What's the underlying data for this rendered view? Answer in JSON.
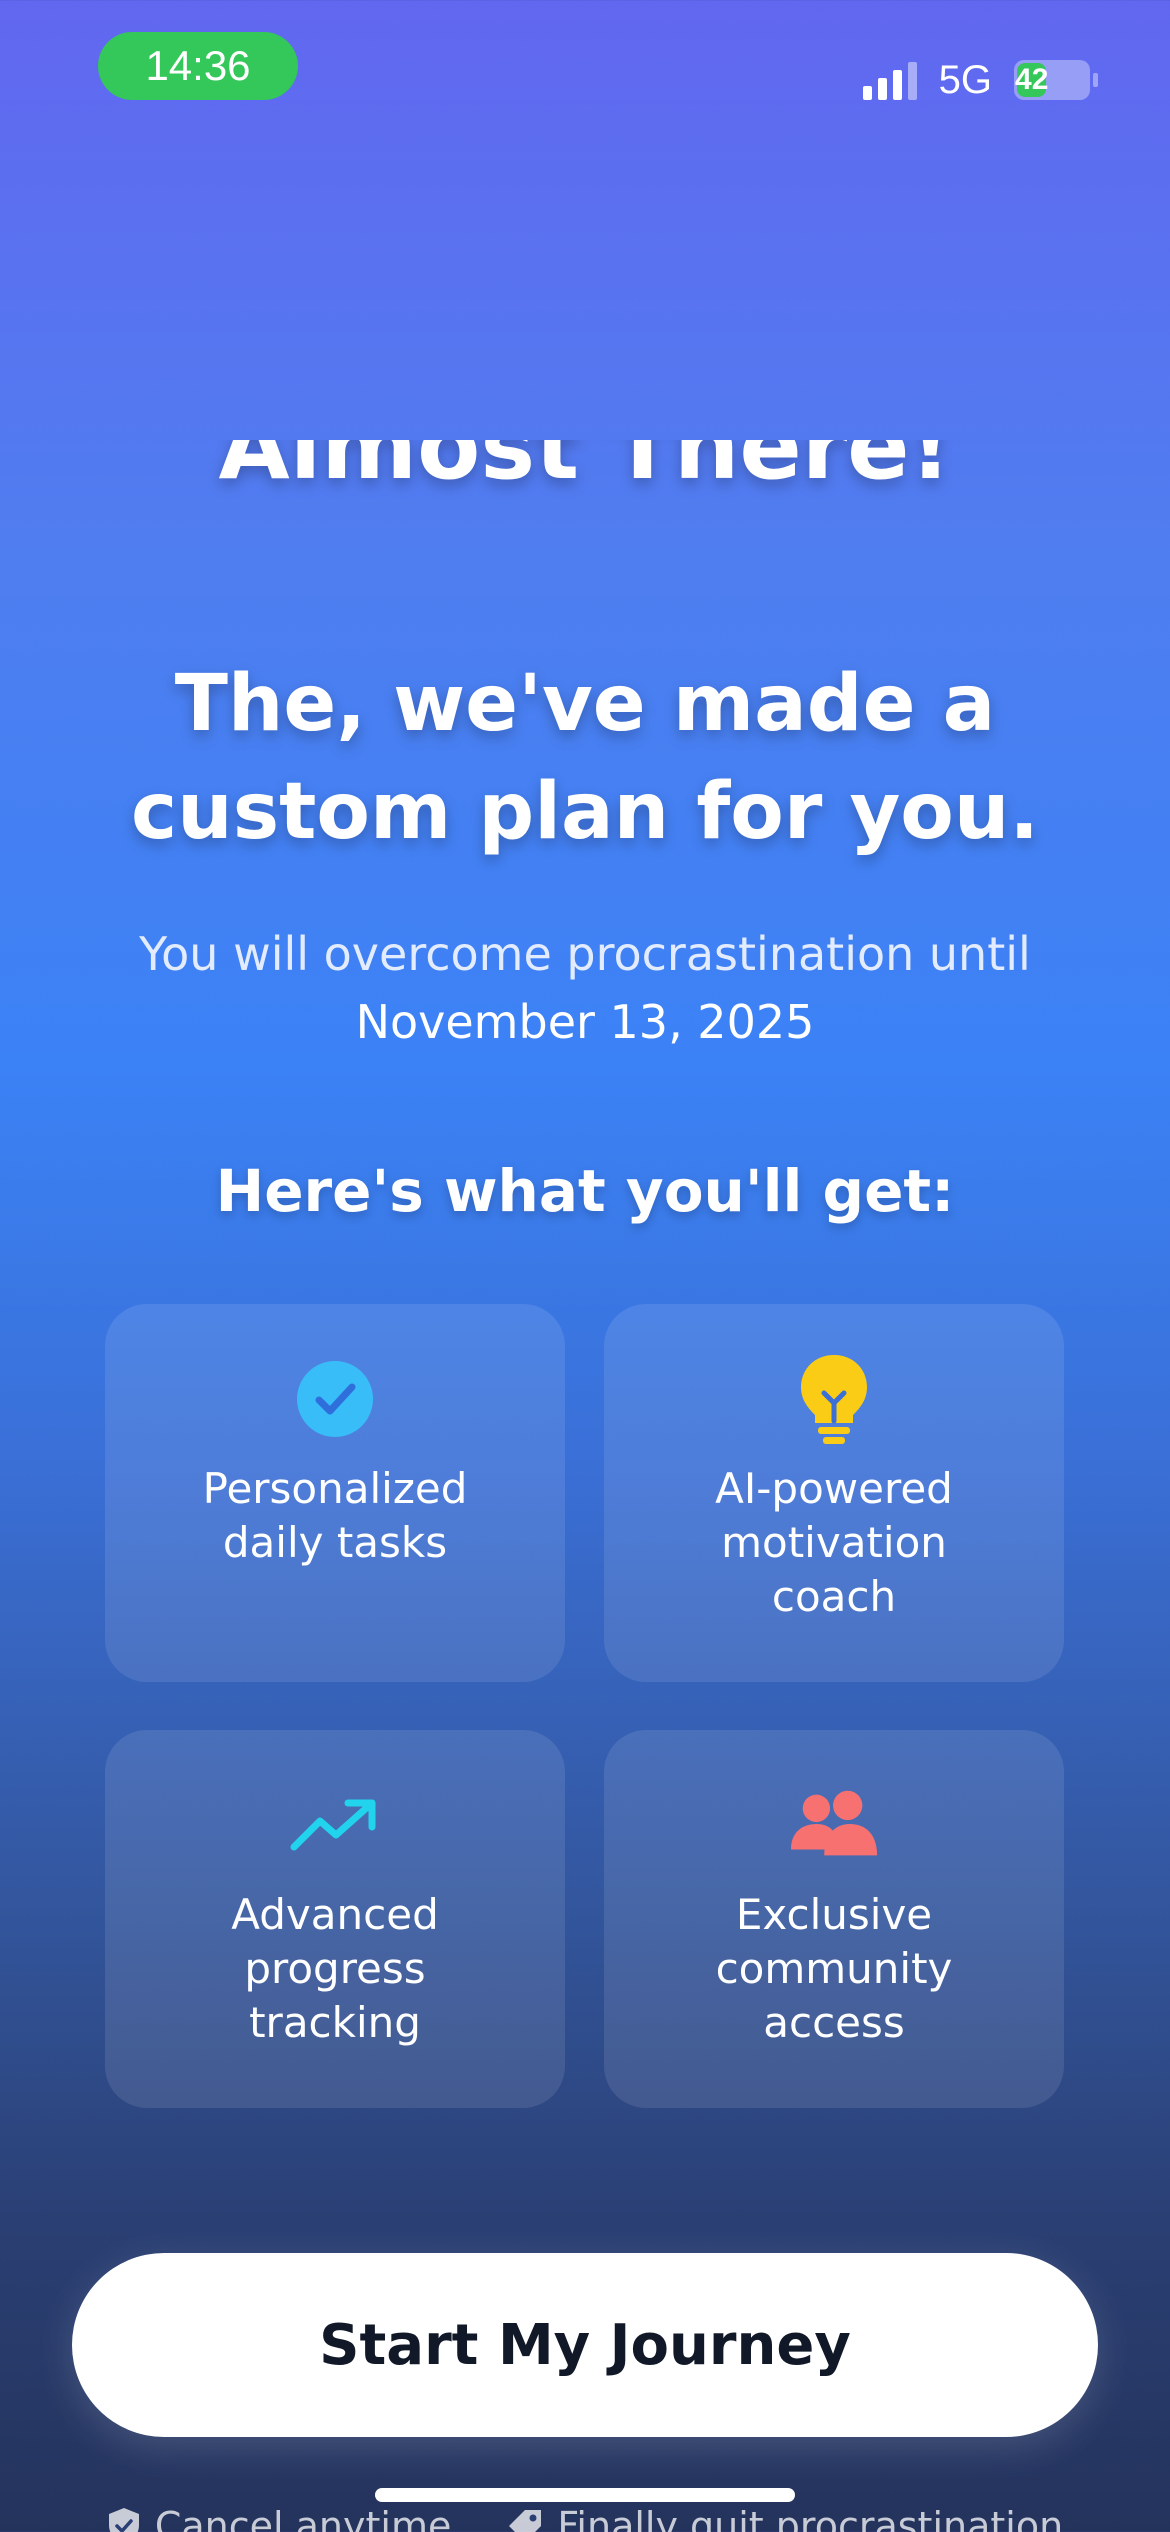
{
  "status_bar": {
    "time": "14:36",
    "network": "5G",
    "battery_level": "42",
    "time_pill_color": "#34c759"
  },
  "title": "Almost There!",
  "headline": "The, we've made a custom plan for you.",
  "subtitle": "You will overcome procrastination until",
  "target_date": "November 13, 2025",
  "section_title": "Here's what you'll get:",
  "features": [
    {
      "label": "Personalized daily tasks",
      "icon": "check-circle-icon",
      "color": "#38bdf8"
    },
    {
      "label": "AI-powered motivation coach",
      "icon": "lightbulb-icon",
      "color": "#facc15"
    },
    {
      "label": "Advanced progress tracking",
      "icon": "trending-up-icon",
      "color": "#22d3ee"
    },
    {
      "label": "Exclusive community access",
      "icon": "users-icon",
      "color": "#f87171"
    }
  ],
  "cta_label": "Start My Journey",
  "footer": {
    "left": "Cancel anytime",
    "right": "Finally quit procrastination"
  }
}
